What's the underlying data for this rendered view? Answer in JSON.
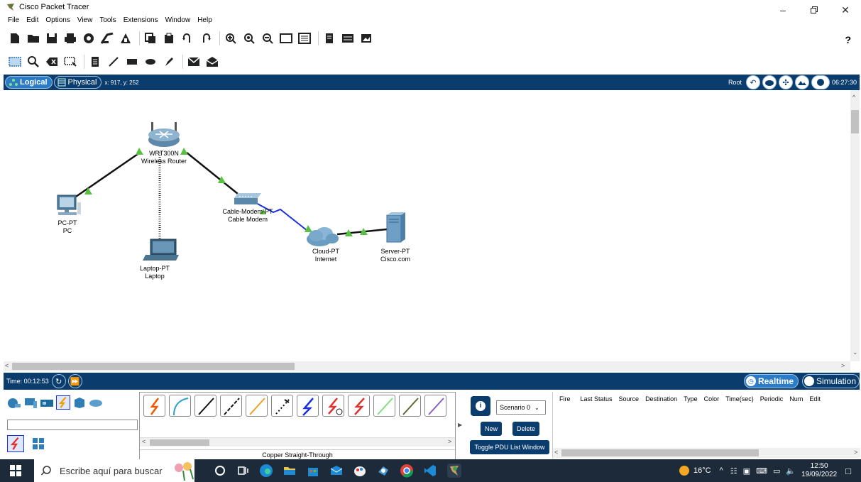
{
  "window": {
    "title": "Cisco Packet Tracer"
  },
  "menu": [
    "File",
    "Edit",
    "Options",
    "View",
    "Tools",
    "Extensions",
    "Window",
    "Help"
  ],
  "help_symbol": "?",
  "logical_bar": {
    "logical_label": "Logical",
    "physical_label": "Physical",
    "coords": "x: 917, y: 252",
    "root_label": "Root",
    "clock": "06:27:30"
  },
  "devices": {
    "router": {
      "model": "WRT300N",
      "name": "Wireless Router"
    },
    "pc": {
      "model": "PC-PT",
      "name": "PC"
    },
    "laptop": {
      "model": "Laptop-PT",
      "name": "Laptop"
    },
    "modem": {
      "model": "Cable-Modem-PT",
      "name": "Cable Modem"
    },
    "cloud": {
      "model": "Cloud-PT",
      "name": "Internet"
    },
    "server": {
      "model": "Server-PT",
      "name": "Cisco.com"
    }
  },
  "timebar": {
    "time": "Time: 00:12:53",
    "realtime_label": "Realtime",
    "simulation_label": "Simulation"
  },
  "cable_panel": {
    "selected_name": "Copper Straight-Through"
  },
  "pdu": {
    "scenario": "Scenario 0",
    "new_label": "New",
    "delete_label": "Delete",
    "toggle_label": "Toggle PDU List Window",
    "columns": [
      "Fire",
      "Last Status",
      "Source",
      "Destination",
      "Type",
      "Color",
      "Time(sec)",
      "Periodic",
      "Num",
      "Edit"
    ]
  },
  "taskbar": {
    "search_placeholder": "Escribe aquí para buscar",
    "temperature": "16°C",
    "time": "12:50",
    "date": "19/09/2022"
  },
  "colors": {
    "dark_bar": "#0a3d6e",
    "link_green": "#58c141",
    "serial_blue": "#1a2fe0"
  }
}
